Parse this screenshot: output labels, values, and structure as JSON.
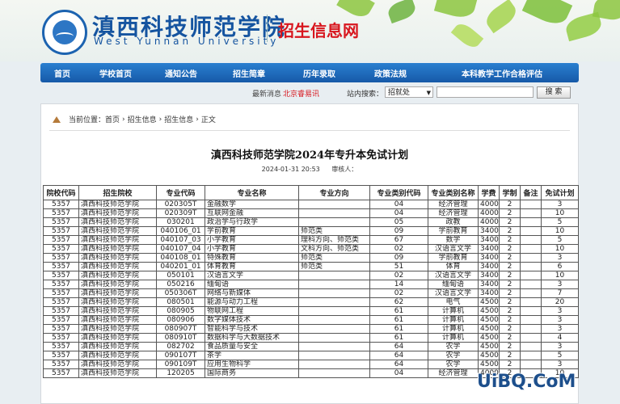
{
  "header": {
    "school_cn": "滇西科技师范学院",
    "school_en": "West Yunnan University",
    "site_title": "招生信息网",
    "brand_color": "#1554a0",
    "accent_color": "#d8161e",
    "logo_icon": "university-seal-icon"
  },
  "nav": {
    "items": [
      {
        "label": "首页"
      },
      {
        "label": "学校首页"
      },
      {
        "label": "通知公告"
      },
      {
        "label": "招生简章"
      },
      {
        "label": "历年录取"
      },
      {
        "label": "政策法规"
      },
      {
        "label": "本科教学工作合格评估"
      }
    ]
  },
  "search": {
    "news_label": "最新消息",
    "news_text": "北京睿易讯",
    "label": "站内搜索：",
    "select_value": "招就处",
    "input_value": "",
    "button_label": "搜 索"
  },
  "breadcrumb": {
    "prefix": "当前位置：",
    "items": [
      "首页",
      "招生信息",
      "招生信息",
      "正文"
    ],
    "separator": "›"
  },
  "article": {
    "title": "滇西科技师范学院2024年专升本免试计划",
    "date": "2024-01-31 20:53",
    "reviewer_label": "审核人："
  },
  "table": {
    "headers": [
      "院校代码",
      "招生院校",
      "专业代码",
      "专业名称",
      "专业方向",
      "专业类别代码",
      "专业类别名称",
      "学费",
      "学制",
      "备注",
      "免试计划"
    ],
    "rows": [
      [
        "5357",
        "滇西科技师范学院",
        "020305T",
        "金融数学",
        "",
        "04",
        "经济管理",
        "4000",
        "2",
        "",
        "3"
      ],
      [
        "5357",
        "滇西科技师范学院",
        "020309T",
        "互联网金融",
        "",
        "04",
        "经济管理",
        "4000",
        "2",
        "",
        "10"
      ],
      [
        "5357",
        "滇西科技师范学院",
        "030201",
        "政治学与行政学",
        "",
        "05",
        "政教",
        "4000",
        "2",
        "",
        "5"
      ],
      [
        "5357",
        "滇西科技师范学院",
        "040106_01",
        "学前教育",
        "师范类",
        "09",
        "学前教育",
        "3400",
        "2",
        "",
        "10"
      ],
      [
        "5357",
        "滇西科技师范学院",
        "040107_03",
        "小学教育",
        "理科方向、师范类",
        "67",
        "数学",
        "3400",
        "2",
        "",
        "5"
      ],
      [
        "5357",
        "滇西科技师范学院",
        "040107_04",
        "小学教育",
        "文科方向、师范类",
        "02",
        "汉语言文学",
        "3400",
        "2",
        "",
        "10"
      ],
      [
        "5357",
        "滇西科技师范学院",
        "040108_01",
        "特殊教育",
        "师范类",
        "09",
        "学前教育",
        "3400",
        "2",
        "",
        "3"
      ],
      [
        "5357",
        "滇西科技师范学院",
        "040201_01",
        "体育教育",
        "师范类",
        "51",
        "体育",
        "3400",
        "2",
        "",
        "6"
      ],
      [
        "5357",
        "滇西科技师范学院",
        "050101",
        "汉语言文学",
        "",
        "02",
        "汉语言文学",
        "3400",
        "2",
        "",
        "10"
      ],
      [
        "5357",
        "滇西科技师范学院",
        "050216",
        "缅甸语",
        "",
        "14",
        "缅甸语",
        "3400",
        "2",
        "",
        "3"
      ],
      [
        "5357",
        "滇西科技师范学院",
        "050306T",
        "网络与新媒体",
        "",
        "02",
        "汉语言文学",
        "3400",
        "2",
        "",
        "7"
      ],
      [
        "5357",
        "滇西科技师范学院",
        "080501",
        "能源与动力工程",
        "",
        "62",
        "电气",
        "4500",
        "2",
        "",
        "20"
      ],
      [
        "5357",
        "滇西科技师范学院",
        "080905",
        "物联网工程",
        "",
        "61",
        "计算机",
        "4500",
        "2",
        "",
        "3"
      ],
      [
        "5357",
        "滇西科技师范学院",
        "080906",
        "数字媒体技术",
        "",
        "61",
        "计算机",
        "4500",
        "2",
        "",
        "3"
      ],
      [
        "5357",
        "滇西科技师范学院",
        "080907T",
        "智能科学与技术",
        "",
        "61",
        "计算机",
        "4500",
        "2",
        "",
        "3"
      ],
      [
        "5357",
        "滇西科技师范学院",
        "080910T",
        "数据科学与大数据技术",
        "",
        "61",
        "计算机",
        "4500",
        "2",
        "",
        "4"
      ],
      [
        "5357",
        "滇西科技师范学院",
        "082702",
        "食品质量与安全",
        "",
        "64",
        "农学",
        "4500",
        "2",
        "",
        "3"
      ],
      [
        "5357",
        "滇西科技师范学院",
        "090107T",
        "茶学",
        "",
        "64",
        "农学",
        "4500",
        "2",
        "",
        "5"
      ],
      [
        "5357",
        "滇西科技师范学院",
        "090109T",
        "应用生物科学",
        "",
        "64",
        "农学",
        "4500",
        "2",
        "",
        "3"
      ],
      [
        "5357",
        "滇西科技师范学院",
        "120205",
        "国际商务",
        "",
        "04",
        "经济管理",
        "4000",
        "2",
        "",
        "10"
      ]
    ]
  },
  "watermark": "UiBQ.CoM"
}
